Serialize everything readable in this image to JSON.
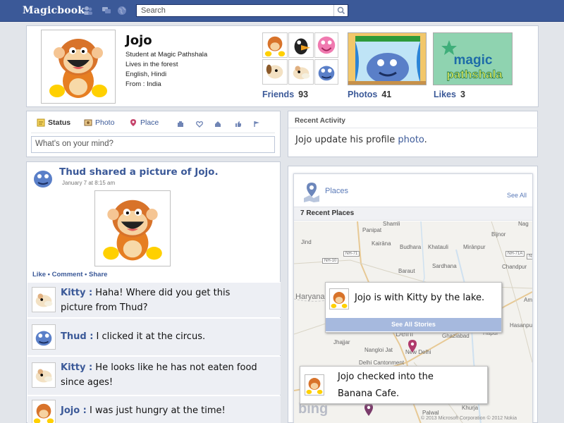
{
  "topbar": {
    "brand": "Magicbook",
    "search_placeholder": "Search"
  },
  "profile": {
    "name": "Jojo",
    "info": [
      "Student at Magic Pathshala",
      "Lives in the forest",
      "English, Hindi",
      "From : India"
    ],
    "friends_label": "Friends",
    "friends_count": "93",
    "photos_label": "Photos",
    "photos_count": "41",
    "likes_label": "Likes",
    "likes_count": "3",
    "likes_page_line1": "magic",
    "likes_page_line2": "pathshala"
  },
  "composer": {
    "tabs": [
      "Status",
      "Photo",
      "Place"
    ],
    "placeholder": "What's on your mind?"
  },
  "recent_activity": {
    "title": "Recent Activity",
    "text": "Jojo update his profile ",
    "link": "photo",
    "end": "."
  },
  "feed": {
    "headline": "Thud shared a picture of Jojo.",
    "date": "January 7 at 8:15 am",
    "actions": "Like • Comment • Share",
    "comments": [
      {
        "who": "Kitty :",
        "line1": " Haha! Where did you get  this",
        "line2": "picture from Thud?"
      },
      {
        "who": "Thud :",
        "line1": " I clicked it at the circus.",
        "line2": ""
      },
      {
        "who": "Kitty :",
        "line1": " He looks like he has not eaten food",
        "line2": "since ages!"
      },
      {
        "who": "Jojo :",
        "line1": " I was just hungry at the time!",
        "line2": ""
      }
    ]
  },
  "places": {
    "title": "Places",
    "see_all": "See All",
    "recent_label": "7 Recent Places",
    "popup1": "Jojo is with Kitty by the lake.",
    "see_all_stories": "See All Stories",
    "popup2_line1": "Jojo checked into the",
    "popup2_line2": "Banana Cafe.",
    "map_labels": [
      "Panipat",
      "Jind",
      "Karnal",
      "Bijnor",
      "Kairāna",
      "Budhara",
      "Khatauli",
      "Mirānpur",
      "Sardhana",
      "Baraut",
      "Chandpur",
      "Haryana",
      "Amr",
      "Hasanpur",
      "Jhajjar",
      "Ghaziabad",
      "Delhi",
      "Nangloi Jat",
      "New Delhi",
      "Delhi Cantonment",
      "Palwal",
      "Khurja",
      "Hapur",
      "NH-71",
      "NH-71A",
      "NH-10",
      "NH-74",
      "Shamli",
      "Nag"
    ],
    "copyright": "© 2013 Microsoft Corporation © 2012 Nokia",
    "bing": "bing"
  },
  "colors": {
    "brand_blue": "#3b5998",
    "link_blue": "#3b5998",
    "comment_bg": "#edeff4"
  }
}
